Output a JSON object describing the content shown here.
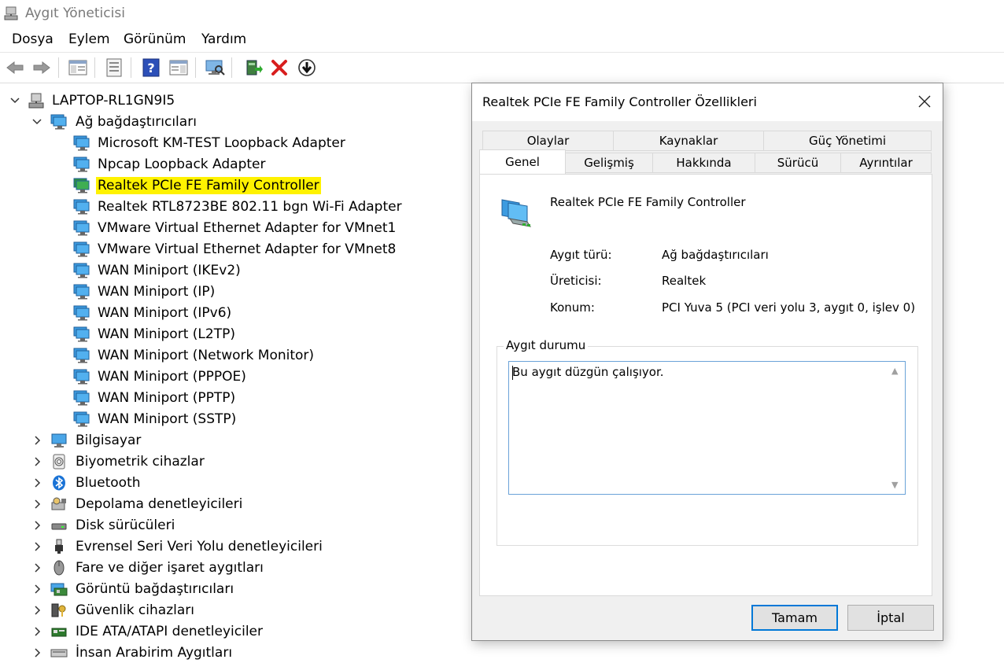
{
  "window": {
    "title": "Aygıt Yöneticisi"
  },
  "menu": [
    "Dosya",
    "Eylem",
    "Görünüm",
    "Yardım"
  ],
  "toolbar": {
    "icons": [
      "back-arrow-icon",
      "forward-arrow-icon",
      "show-hide-tree-icon",
      "properties-icon",
      "help-icon",
      "action-pane-icon",
      "scan-hardware-icon",
      "update-driver-icon",
      "uninstall-icon",
      "disable-device-icon"
    ]
  },
  "tree": {
    "root": "LAPTOP-RL1GN9I5",
    "network_category": "Ağ bağdaştırıcıları",
    "network_adapters": [
      "Microsoft KM-TEST Loopback Adapter",
      "Npcap Loopback Adapter",
      "Realtek PCIe FE Family Controller",
      "Realtek RTL8723BE 802.11 bgn Wi-Fi Adapter",
      "VMware Virtual Ethernet Adapter for VMnet1",
      "VMware Virtual Ethernet Adapter for VMnet8",
      "WAN Miniport (IKEv2)",
      "WAN Miniport (IP)",
      "WAN Miniport (IPv6)",
      "WAN Miniport (L2TP)",
      "WAN Miniport (Network Monitor)",
      "WAN Miniport (PPPOE)",
      "WAN Miniport (PPTP)",
      "WAN Miniport (SSTP)"
    ],
    "selected_index": 2,
    "categories": [
      "Bilgisayar",
      "Biyometrik cihazlar",
      "Bluetooth",
      "Depolama denetleyicileri",
      "Disk sürücüleri",
      "Evrensel Seri Veri Yolu denetleyicileri",
      "Fare ve diğer işaret aygıtları",
      "Görüntü bağdaştırıcıları",
      "Güvenlik cihazları",
      "IDE ATA/ATAPI denetleyiciler",
      "İnsan Arabirim Aygıtları"
    ],
    "category_icons": [
      "computer-icon",
      "fingerprint-icon",
      "bluetooth-icon",
      "storage-controller-icon",
      "disk-drive-icon",
      "usb-icon",
      "mouse-icon",
      "display-adapter-icon",
      "security-key-icon",
      "ide-controller-icon",
      "hid-icon"
    ],
    "highlight_color": "#fff200"
  },
  "dialog": {
    "title": "Realtek PCIe FE Family Controller Özellikleri",
    "tabs_row1": [
      "Olaylar",
      "Kaynaklar",
      "Güç Yönetimi"
    ],
    "tabs_row2": [
      "Genel",
      "Gelişmiş",
      "Hakkında",
      "Sürücü",
      "Ayrıntılar"
    ],
    "active_tab": "Genel",
    "device_name": "Realtek PCIe FE Family Controller",
    "props": [
      {
        "label": "Aygıt türü:",
        "value": "Ağ bağdaştırıcıları"
      },
      {
        "label": "Üreticisi:",
        "value": "Realtek"
      },
      {
        "label": "Konum:",
        "value": "PCI Yuva 5 (PCI veri yolu 3, aygıt 0, işlev 0)"
      }
    ],
    "status_group_label": "Aygıt durumu",
    "status_text": "Bu aygıt düzgün çalışıyor.",
    "ok_label": "Tamam",
    "cancel_label": "İptal",
    "accent_color": "#0078d7"
  }
}
